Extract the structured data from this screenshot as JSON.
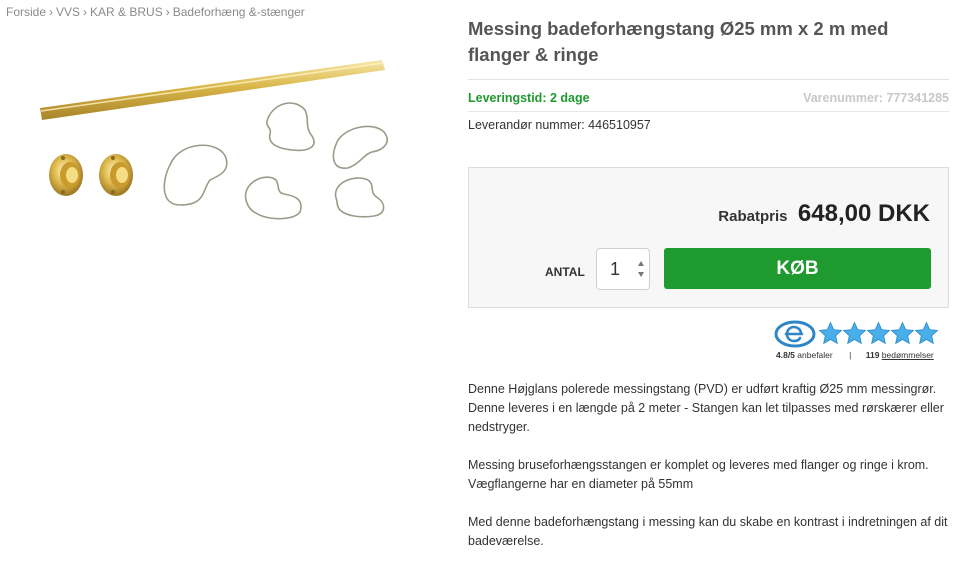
{
  "breadcrumb": {
    "items": [
      "Forside",
      "VVS",
      "KAR & BRUS",
      "Badeforhæng &-stænger"
    ],
    "separator": "›"
  },
  "product": {
    "title": "Messing badeforhængstang Ø25 mm x 2 m med flanger & ringe",
    "delivery": "Leveringstid: 2 dage",
    "item_number": "Varenummer: 777341285",
    "supplier": "Leverandør nummer: 446510957",
    "image_icon": "brass-shower-rod-with-flanges-and-rings"
  },
  "purchase": {
    "price_label": "Rabatpris",
    "price": "648,00 DKK",
    "quantity_label": "ANTAL",
    "quantity": "1",
    "buy_label": "KØB"
  },
  "rating": {
    "score": "4.8/5",
    "recommend": "anbefaler",
    "separator": "|",
    "count": "119",
    "reviews_label": "bedømmelser",
    "stars": 5,
    "logo_icon": "e-maerket-icon"
  },
  "description": [
    "Denne Højglans polerede messingstang (PVD) er udført kraftig Ø25 mm messingrør. Denne leveres i en længde på 2 meter - Stangen kan let tilpasses med rørskærer eller nedstryger.",
    "Messing bruseforhængsstangen er komplet og leveres med flanger og ringe i krom. Vægflangerne har en diameter på 55mm",
    "Med denne badeforhængstang i messing kan du skabe en kontrast i indretningen af dit badeværelse."
  ],
  "colors": {
    "accent_green": "#1f9a2f",
    "star_blue": "#4aaee8",
    "brass": "#d9b648"
  }
}
